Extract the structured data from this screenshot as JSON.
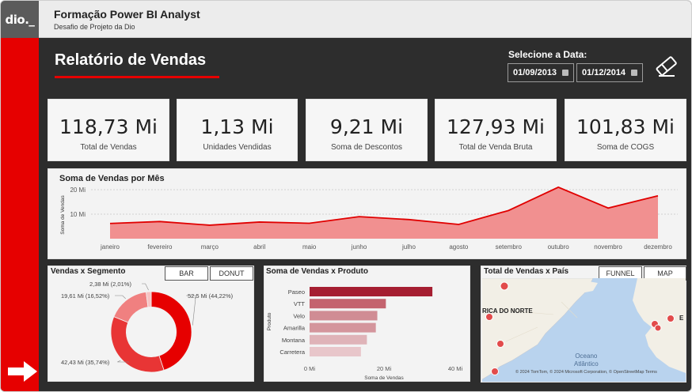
{
  "app": {
    "logo": "dio._",
    "title": "Formação Power BI Analyst",
    "subtitle": "Desafio de Projeto da Dio"
  },
  "report": {
    "title": "Relatório de Vendas",
    "date_filter_label": "Selecione a Data:",
    "date_start": "01/09/2013",
    "date_end": "01/12/2014"
  },
  "kpis": [
    {
      "value": "118,73 Mi",
      "label": "Total de Vendas"
    },
    {
      "value": "1,13 Mi",
      "label": "Unidades Vendidas"
    },
    {
      "value": "9,21 Mi",
      "label": "Soma de Descontos"
    },
    {
      "value": "127,93 Mi",
      "label": "Total de Venda Bruta"
    },
    {
      "value": "101,83 Mi",
      "label": "Soma de COGS"
    }
  ],
  "colors": {
    "accent": "#e60000",
    "background": "#2d2d2d",
    "area_fill": "#f19090",
    "line": "#e00000"
  },
  "chart_data": [
    {
      "type": "area",
      "title": "Soma de Vendas por Mês",
      "ylabel": "Soma de Vendas",
      "yticks": [
        "10 Mi",
        "20 Mi"
      ],
      "ylim": [
        0,
        25
      ],
      "grid": true,
      "categories": [
        "janeiro",
        "fevereiro",
        "março",
        "abril",
        "maio",
        "junho",
        "julho",
        "agosto",
        "setembro",
        "outubro",
        "novembro",
        "dezembro"
      ],
      "values": [
        6.2,
        7.0,
        5.5,
        6.8,
        6.3,
        9.0,
        7.8,
        5.8,
        11.5,
        21.0,
        12.5,
        17.5
      ]
    },
    {
      "type": "pie",
      "title": "Vendas x Segmento",
      "labels": [
        "52,5 Mi (44,22%)",
        "42,43 Mi (35,74%)",
        "19,61 Mi (16,52%)",
        "2,38 Mi (2,01%)"
      ],
      "values": [
        52.5,
        42.43,
        19.61,
        2.38
      ],
      "percents": [
        44.22,
        35.74,
        16.52,
        2.01
      ],
      "slice_colors": [
        "#e60000",
        "#e83535",
        "#f08080",
        "#f7c3c3"
      ],
      "hole": 0.62
    },
    {
      "type": "bar",
      "orientation": "horizontal",
      "title": "Soma de Vendas x Produto",
      "xlabel": "Soma de Vendas",
      "ylabel": "Produto",
      "categories": [
        "Paseo",
        "VTT",
        "Velo",
        "Amarilla",
        "Montana",
        "Carretera"
      ],
      "values": [
        33.0,
        20.5,
        18.2,
        17.8,
        15.4,
        13.8
      ],
      "bar_colors": [
        "#a51e31",
        "#c4636e",
        "#d08c94",
        "#d4959c",
        "#dfb3b8",
        "#e8c6ca"
      ],
      "xticks": [
        "0 Mi",
        "20 Mi",
        "40 Mi"
      ],
      "xlim": [
        0,
        40
      ]
    }
  ],
  "segment_toggle": {
    "bar": "BAR",
    "donut": "DONUT"
  },
  "map_panel": {
    "title": "Total de Vendas x País",
    "funnel": "FUNNEL",
    "map": "MAP",
    "label_country": "RICA DO NORTE",
    "label_edge": "E",
    "ocean_line1": "Oceano",
    "ocean_line2": "Atlântico",
    "copyright": "© 2024 TomTom, © 2024 Microsoft Corporation, © OpenStreetMap  Terms"
  },
  "icons": {
    "eraser": "eraser-icon",
    "calendar": "calendar-icon",
    "arrow": "arrow-right-icon"
  }
}
